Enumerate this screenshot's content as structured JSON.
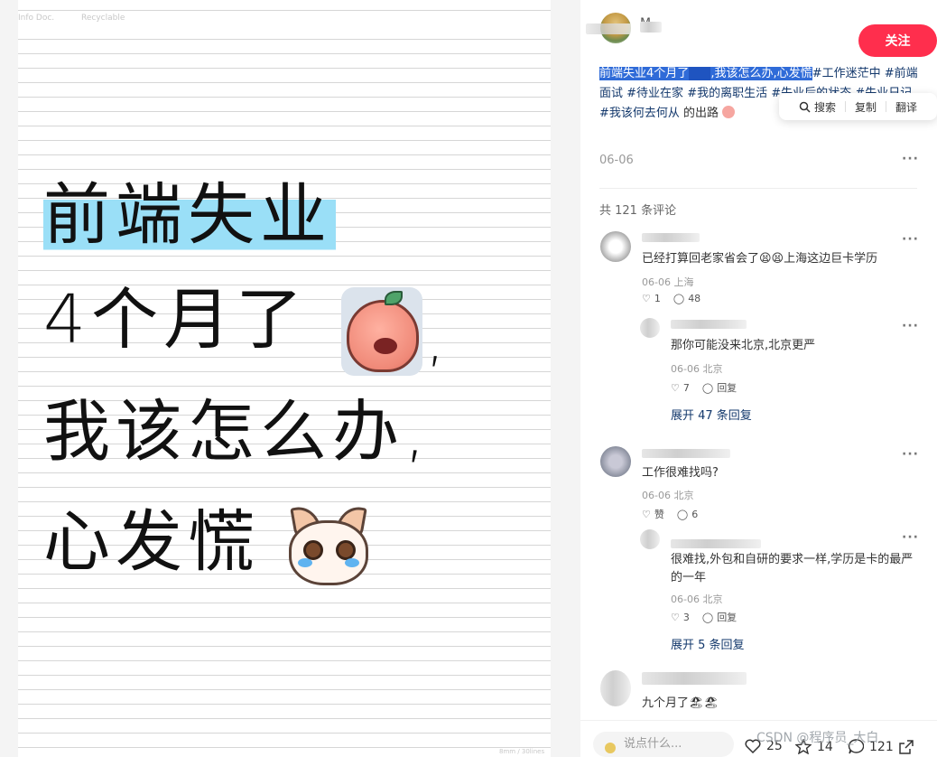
{
  "image": {
    "header_left": "Info Doc.",
    "header_right": "Recyclable",
    "footer": "8mm / 30lines",
    "headline_1": "前端失业",
    "headline_2": "4个月了",
    "headline_3": "我该怎么办,",
    "headline_4": "心发慌",
    "comma": ","
  },
  "post": {
    "author_name": "M",
    "follow_label": "关注",
    "desc_selected_1": "前端失业4个月了",
    "desc_selected_2": ",我该怎么办,心发慌",
    "tags": [
      "#工作迷茫中",
      "#前端面试",
      "#待业在家",
      "#我的离职生活",
      "#失业后的状态",
      "#失业日记",
      "#我该何去何从"
    ],
    "desc_tail": "的出路",
    "date": "06-06",
    "more": "···",
    "selection_toolbar": {
      "search": "搜索",
      "copy": "复制",
      "translate": "翻译"
    },
    "comment_count": "共 121 条评论"
  },
  "comments": [
    {
      "text": "已经打算回老家省会了😫😫上海这边巨卡学历",
      "meta": "06-06 上海",
      "likes": "1",
      "replies": "48"
    },
    {
      "text": "那你可能没来北京,北京更严",
      "meta": "06-06 北京",
      "likes": "7",
      "replies": "回复",
      "expand": "展开 47 条回复"
    },
    {
      "text": "工作很难找吗?",
      "meta": "06-06 北京",
      "likes": "赞",
      "replies": "6"
    },
    {
      "text": "很难找,外包和自研的要求一样,学历是卡的最严的一年",
      "meta": "06-06 北京",
      "likes": "3",
      "replies": "回复",
      "expand": "展开 5 条回复"
    },
    {
      "text": "九个月了🏖🏖"
    }
  ],
  "bottom": {
    "input_placeholder": "说点什么...",
    "likes": "25",
    "stars": "14",
    "comments": "121"
  },
  "watermark": "CSDN @程序员_大白"
}
